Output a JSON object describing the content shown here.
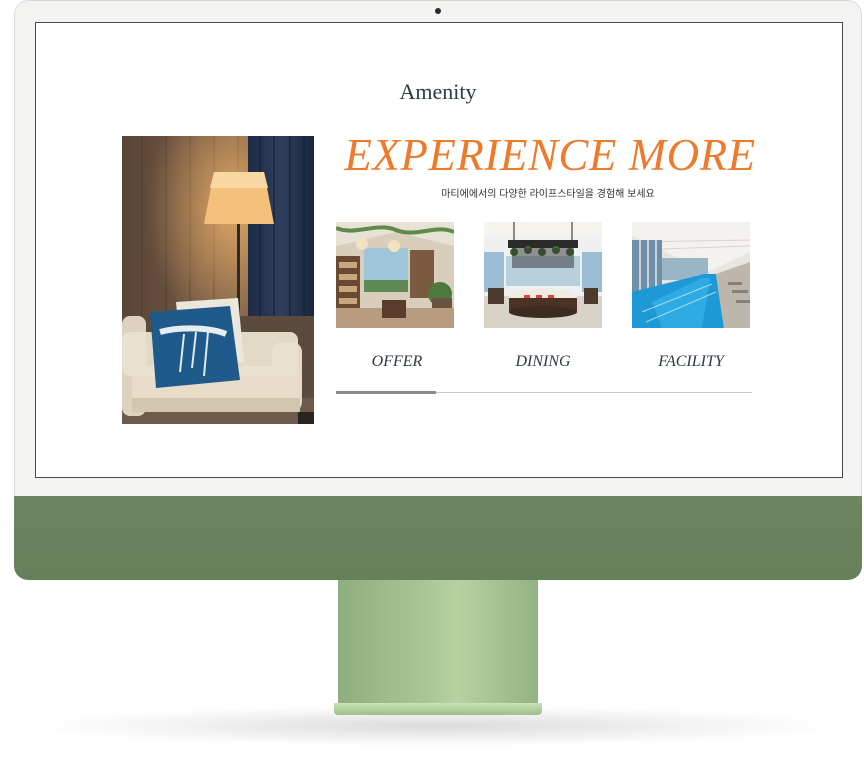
{
  "site": {
    "section_title": "Amenity",
    "headline": "EXPERIENCE MORE",
    "subtitle": "마티에에서의 다양한 라이프스타일을 경험해 보세요",
    "cards": [
      {
        "label": "OFFER"
      },
      {
        "label": "DINING"
      },
      {
        "label": "FACILITY"
      }
    ],
    "slider": {
      "active_index": 1,
      "total": 3
    }
  },
  "colors": {
    "headline": "#ee7a2c",
    "text": "#2f3a40",
    "monitor_chin": "#6e8562",
    "monitor_stand": "#a9c696"
  },
  "icons": {
    "camera": "camera-icon"
  }
}
